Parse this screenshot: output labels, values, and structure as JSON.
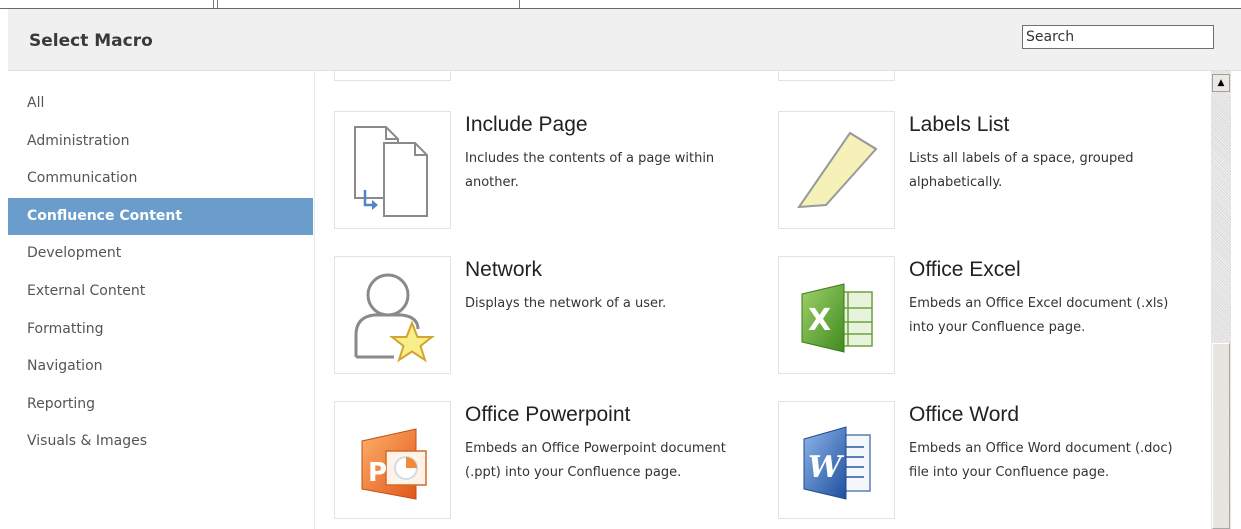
{
  "dialog": {
    "title": "Select Macro",
    "search_placeholder": "Search"
  },
  "sidebar": {
    "items": [
      {
        "label": "All"
      },
      {
        "label": "Administration"
      },
      {
        "label": "Communication"
      },
      {
        "label": "Confluence Content",
        "active": true
      },
      {
        "label": "Development"
      },
      {
        "label": "External Content"
      },
      {
        "label": "Formatting"
      },
      {
        "label": "Navigation"
      },
      {
        "label": "Reporting"
      },
      {
        "label": "Visuals & Images"
      }
    ]
  },
  "macros": [
    {
      "name": "Include Page",
      "desc": "Includes the contents of a page within another.",
      "icon": "include-page-icon"
    },
    {
      "name": "Labels List",
      "desc": "Lists all labels of a space, grouped alphabetically.",
      "icon": "label-tag-icon"
    },
    {
      "name": "Network",
      "desc": "Displays the network of a user.",
      "icon": "network-user-icon"
    },
    {
      "name": "Office Excel",
      "desc": "Embeds an Office Excel document (.xls) into your Confluence page.",
      "icon": "excel-icon"
    },
    {
      "name": "Office Powerpoint",
      "desc": "Embeds an Office Powerpoint document (.ppt) into your Confluence page.",
      "icon": "powerpoint-icon"
    },
    {
      "name": "Office Word",
      "desc": "Embeds an Office Word document (.doc) file into your Confluence page.",
      "icon": "word-icon"
    }
  ],
  "colors": {
    "active_category": "#6a9dcc",
    "header_bg": "#f0f0f0"
  }
}
